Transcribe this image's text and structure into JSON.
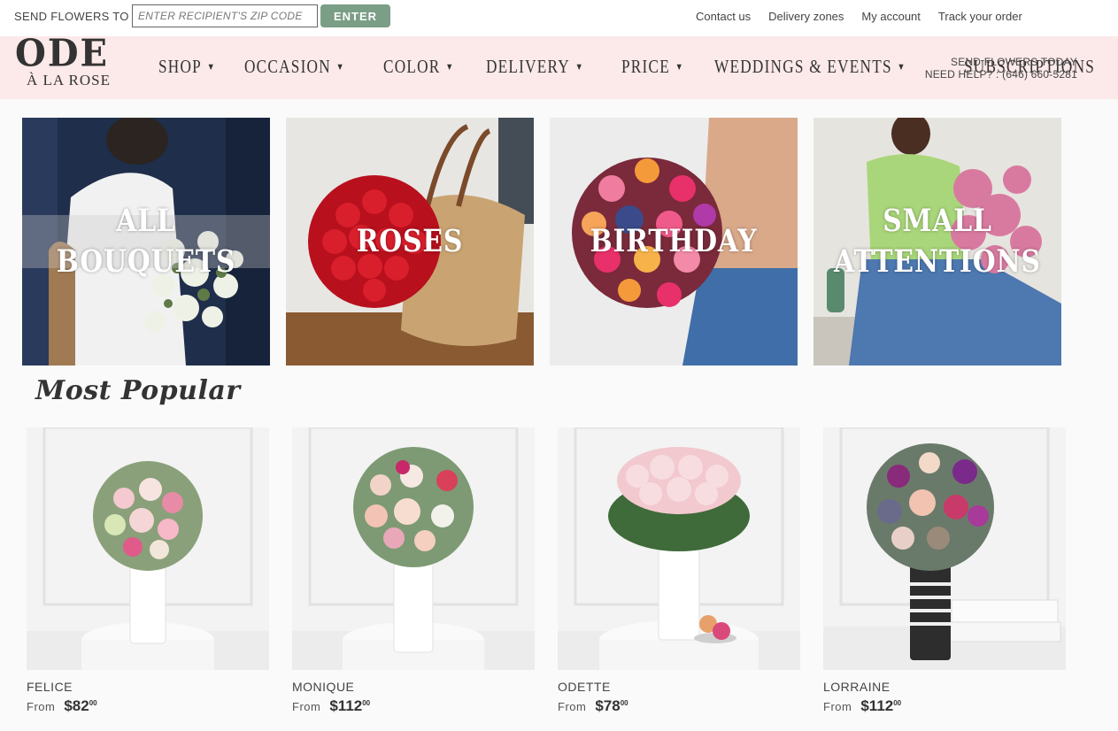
{
  "topbar": {
    "zip_label": "SEND FLOWERS TO",
    "zip_placeholder": "ENTER RECIPIENT'S ZIP CODE",
    "enter_label": "ENTER",
    "links": [
      "Contact us",
      "Delivery zones",
      "My account",
      "Track your order"
    ]
  },
  "header": {
    "logo_top": "ODE",
    "logo_bottom": "À LA ROSE",
    "nav": [
      {
        "label": "SHOP",
        "dropdown": true
      },
      {
        "label": "OCCASION",
        "dropdown": true
      },
      {
        "label": "COLOR",
        "dropdown": true
      },
      {
        "label": "DELIVERY",
        "dropdown": true
      },
      {
        "label": "PRICE",
        "dropdown": true
      },
      {
        "label": "WEDDINGS & EVENTS",
        "dropdown": true
      },
      {
        "label": "SUBSCRIPTIONS",
        "dropdown": false
      }
    ],
    "help_line1": "SEND FLOWERS TODAY",
    "help_line2": "NEED HELP? : (646) 660-5281"
  },
  "categories": [
    {
      "label": "ALL BOUQUETS"
    },
    {
      "label": "ROSES"
    },
    {
      "label": "BIRTHDAY"
    },
    {
      "label": "SMALL ATTENTIONS"
    }
  ],
  "popular": {
    "title": "Most Popular",
    "products": [
      {
        "name": "FELICE",
        "from": "From",
        "price": "$82",
        "cents": "00"
      },
      {
        "name": "MONIQUE",
        "from": "From",
        "price": "$112",
        "cents": "00"
      },
      {
        "name": "ODETTE",
        "from": "From",
        "price": "$78",
        "cents": "00"
      },
      {
        "name": "LORRAINE",
        "from": "From",
        "price": "$112",
        "cents": "00"
      }
    ]
  },
  "colors": {
    "header_bg": "#fce9e9",
    "enter_button": "#7a9e86"
  }
}
